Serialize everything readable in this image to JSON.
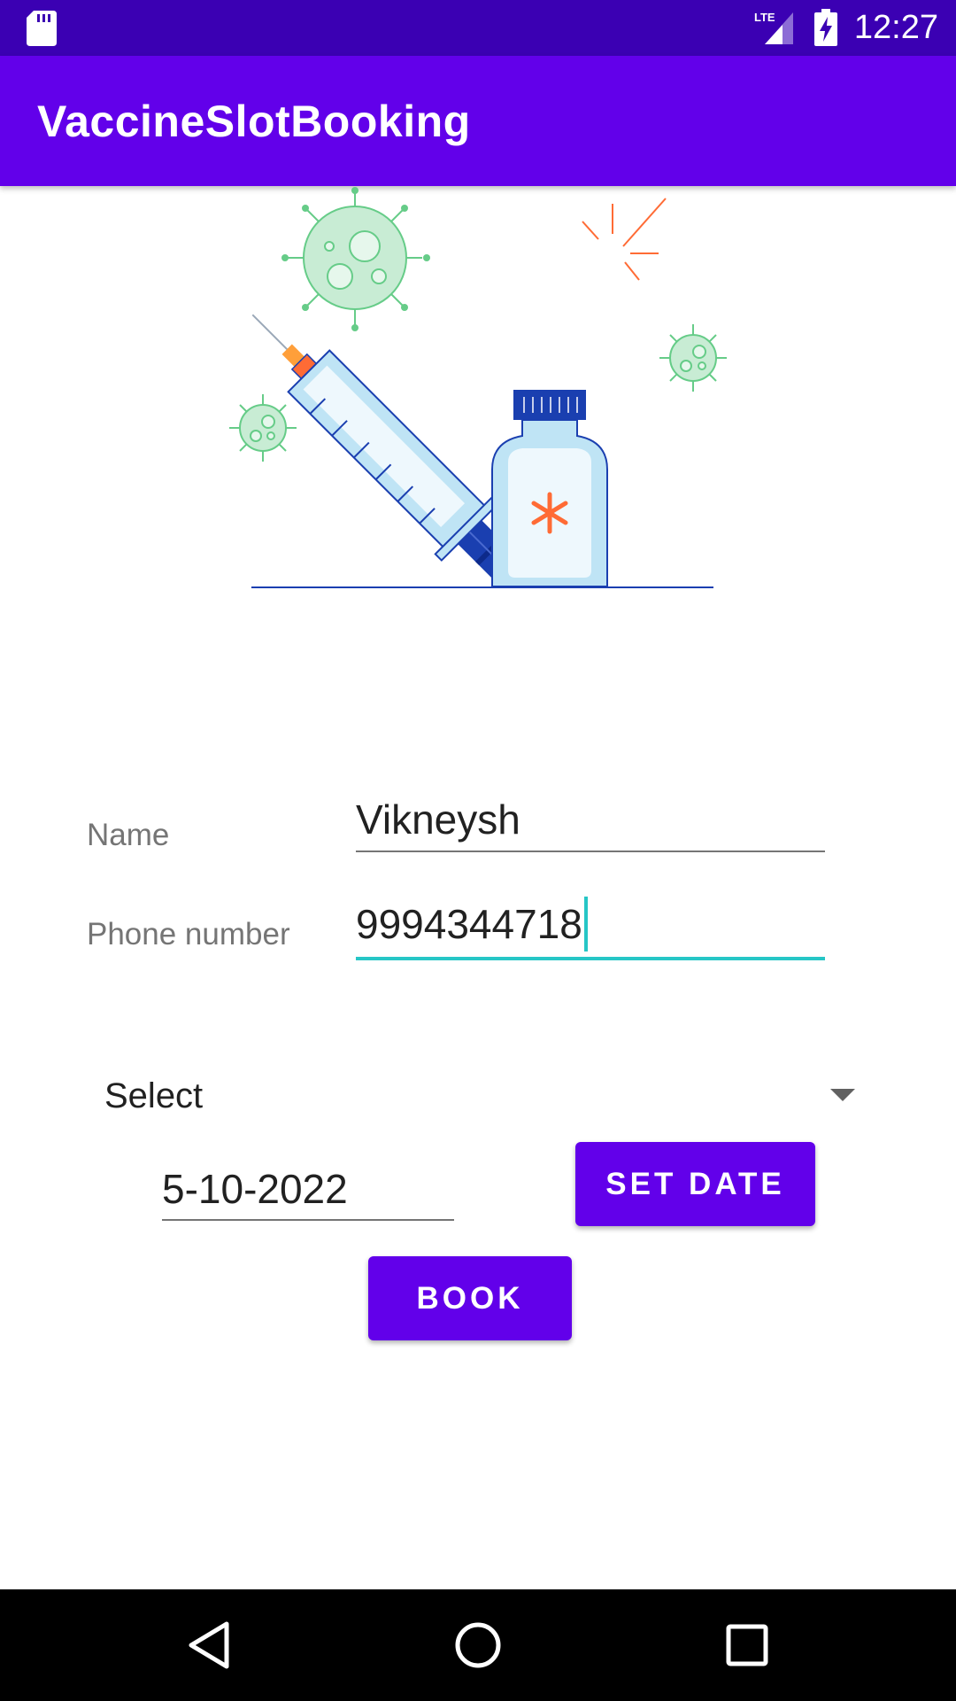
{
  "status_bar": {
    "time": "12:27",
    "network_label": "LTE",
    "icons": [
      "sd-card-icon",
      "lte-signal-icon",
      "battery-charging-icon"
    ]
  },
  "app_bar": {
    "title": "VaccineSlotBooking"
  },
  "illustration": {
    "icon": "vaccine-syringe-illustration"
  },
  "form": {
    "name_label": "Name",
    "name_value": "Vikneysh",
    "phone_label": "Phone number",
    "phone_value": "9994344718",
    "spinner_value": "Select",
    "date_value": "5-10-2022",
    "set_date_label": "SET DATE",
    "book_label": "BOOK"
  },
  "nav_bar": {
    "icons": [
      "back-icon",
      "home-icon",
      "recents-icon"
    ]
  },
  "colors": {
    "status_bar": "#3b00b3",
    "primary": "#6200ea",
    "focus_accent": "#26c6c6",
    "virus_green": "#66cc88",
    "syringe_blue": "#1a3fb0",
    "accent_orange": "#ff6b35"
  }
}
